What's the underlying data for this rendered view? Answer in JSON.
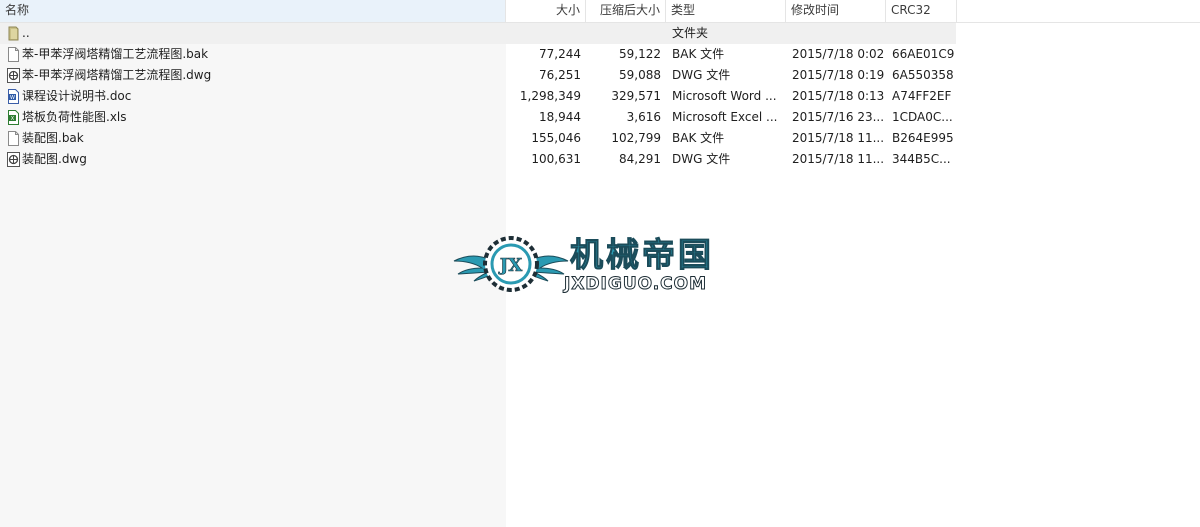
{
  "columns": {
    "name": "名称",
    "size": "大小",
    "packed": "压缩后大小",
    "type": "类型",
    "modified": "修改时间",
    "crc": "CRC32"
  },
  "parent_row": {
    "name": "..",
    "type": "文件夹"
  },
  "files": [
    {
      "name": "苯-甲苯浮阀塔精馏工艺流程图.bak",
      "size": "77,244",
      "packed": "59,122",
      "type": "BAK 文件",
      "modified": "2015/7/18 0:02",
      "crc": "66AE01C9",
      "icon": "blank-file-icon"
    },
    {
      "name": "苯-甲苯浮阀塔精馏工艺流程图.dwg",
      "size": "76,251",
      "packed": "59,088",
      "type": "DWG 文件",
      "modified": "2015/7/18 0:19",
      "crc": "6A550358",
      "icon": "dwg-file-icon"
    },
    {
      "name": "课程设计说明书.doc",
      "size": "1,298,349",
      "packed": "329,571",
      "type": "Microsoft Word ...",
      "modified": "2015/7/18 0:13",
      "crc": "A74FF2EF",
      "icon": "word-file-icon"
    },
    {
      "name": "塔板负荷性能图.xls",
      "size": "18,944",
      "packed": "3,616",
      "type": "Microsoft Excel ...",
      "modified": "2015/7/16 23...",
      "crc": "1CDA0C...",
      "icon": "excel-file-icon"
    },
    {
      "name": "装配图.bak",
      "size": "155,046",
      "packed": "102,799",
      "type": "BAK 文件",
      "modified": "2015/7/18 11...",
      "crc": "B264E995",
      "icon": "blank-file-icon"
    },
    {
      "name": "装配图.dwg",
      "size": "100,631",
      "packed": "84,291",
      "type": "DWG 文件",
      "modified": "2015/7/18 11...",
      "crc": "344B5C...",
      "icon": "dwg-file-icon"
    }
  ],
  "watermark": {
    "logo_letters": "JX",
    "title": "机械帝国",
    "subtitle": "JXDIGUO.COM"
  },
  "colors": {
    "name_column_bg": "#f7f7f7",
    "header_highlight": "#e9f2fa",
    "watermark_teal": "#2a9ab2"
  }
}
